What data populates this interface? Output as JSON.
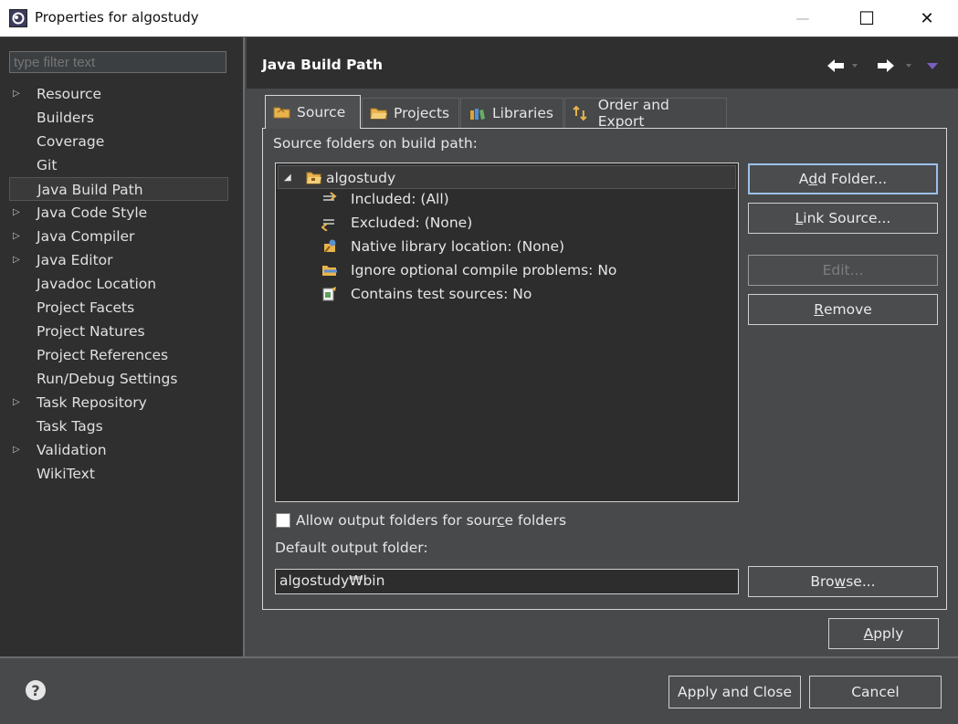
{
  "window": {
    "title": "Properties for algostudy",
    "controls": {
      "minimize": "—",
      "maximize": "☐",
      "close": "✕"
    }
  },
  "filter": {
    "placeholder": "type filter text",
    "value": ""
  },
  "nav": [
    {
      "label": "Resource",
      "expandable": true
    },
    {
      "label": "Builders",
      "expandable": false
    },
    {
      "label": "Coverage",
      "expandable": false
    },
    {
      "label": "Git",
      "expandable": false
    },
    {
      "label": "Java Build Path",
      "expandable": false,
      "selected": true
    },
    {
      "label": "Java Code Style",
      "expandable": true
    },
    {
      "label": "Java Compiler",
      "expandable": true
    },
    {
      "label": "Java Editor",
      "expandable": true
    },
    {
      "label": "Javadoc Location",
      "expandable": false
    },
    {
      "label": "Project Facets",
      "expandable": false
    },
    {
      "label": "Project Natures",
      "expandable": false
    },
    {
      "label": "Project References",
      "expandable": false
    },
    {
      "label": "Run/Debug Settings",
      "expandable": false
    },
    {
      "label": "Task Repository",
      "expandable": true
    },
    {
      "label": "Task Tags",
      "expandable": false
    },
    {
      "label": "Validation",
      "expandable": true
    },
    {
      "label": "WikiText",
      "expandable": false
    }
  ],
  "page": {
    "title": "Java Build Path"
  },
  "tabs": [
    {
      "label": "Source",
      "icon": "source-folder-icon",
      "active": true
    },
    {
      "label": "Projects",
      "icon": "projects-icon",
      "active": false
    },
    {
      "label": "Libraries",
      "icon": "libraries-icon",
      "active": false
    },
    {
      "label": "Order and Export",
      "icon": "order-export-icon",
      "active": false
    }
  ],
  "source": {
    "label": "Source folders on build path:",
    "root": {
      "label": "algostudy",
      "icon": "package-folder-icon"
    },
    "children": [
      {
        "label": "Included: (All)",
        "icon": "included-filter-icon"
      },
      {
        "label": "Excluded: (None)",
        "icon": "excluded-filter-icon"
      },
      {
        "label": "Native library location: (None)",
        "icon": "native-library-icon"
      },
      {
        "label": "Ignore optional compile problems: No",
        "icon": "ignore-problems-icon"
      },
      {
        "label": "Contains test sources: No",
        "icon": "test-sources-icon"
      }
    ]
  },
  "buttons": {
    "add_folder": {
      "pre": "A",
      "mn": "d",
      "post": "d Folder..."
    },
    "link_source": {
      "pre": "",
      "mn": "L",
      "post": "ink Source..."
    },
    "edit": "Edit...",
    "remove": {
      "pre": "",
      "mn": "R",
      "post": "emove"
    },
    "browse": {
      "pre": "Bro",
      "mn": "w",
      "post": "se..."
    },
    "apply": {
      "pre": "",
      "mn": "A",
      "post": "pply"
    },
    "apply_close": "Apply and Close",
    "cancel": "Cancel"
  },
  "allow_output": {
    "pre": "Allow output folders for sour",
    "mn": "c",
    "post": "e folders",
    "checked": false
  },
  "output": {
    "label": "Default output folder:",
    "value": "algostudy₩bin"
  },
  "colors": {
    "background": "#47494b",
    "pane": "#2f2f2f",
    "field": "#2d2d2d",
    "focus": "#9ec0e8",
    "folder": "#e9b44c"
  }
}
